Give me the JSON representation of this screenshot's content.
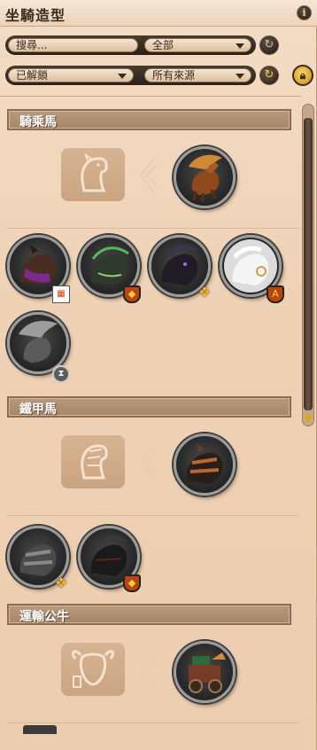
{
  "window": {
    "title": "坐騎造型"
  },
  "filters": {
    "search_placeholder": "搜尋...",
    "category_value": "全部",
    "status_value": "已解鎖",
    "source_value": "所有來源"
  },
  "sections": [
    {
      "title": "騎乘馬",
      "category_icon": "horse-head-icon"
    },
    {
      "title": "鐵甲馬",
      "category_icon": "armored-horse-head-icon"
    },
    {
      "title": "運輸公牛",
      "category_icon": "ox-head-icon"
    }
  ],
  "mounts": {
    "riding_featured": {
      "name": "winged-horse",
      "color": "#a05a1f"
    },
    "riding_grid": [
      {
        "color": "#4a2d22",
        "badge": "calendar-icon"
      },
      {
        "color": "#2f3a2c",
        "badge": "shield-icon"
      },
      {
        "color": "#1f1c26",
        "badge": "gold-emblem-icon"
      },
      {
        "color": "#e9e9e9",
        "badge": "shield-a-icon"
      },
      {
        "color": "#5b5b5b",
        "badge": "hourglass-icon"
      }
    ],
    "armored_featured": {
      "name": "armored-horse",
      "color": "#6a3a25"
    },
    "armored_grid": [
      {
        "color": "#4b4b4b",
        "badge": "gold-emblem-icon"
      },
      {
        "color": "#1a1a1a",
        "badge": "shield-icon"
      }
    ],
    "ox_featured": {
      "name": "ox-cart",
      "color": "#5a4030"
    }
  },
  "colors": {
    "accent": "#e0a31c",
    "header_bg": "#a6866b",
    "panel_bg": "#efd3b8"
  }
}
